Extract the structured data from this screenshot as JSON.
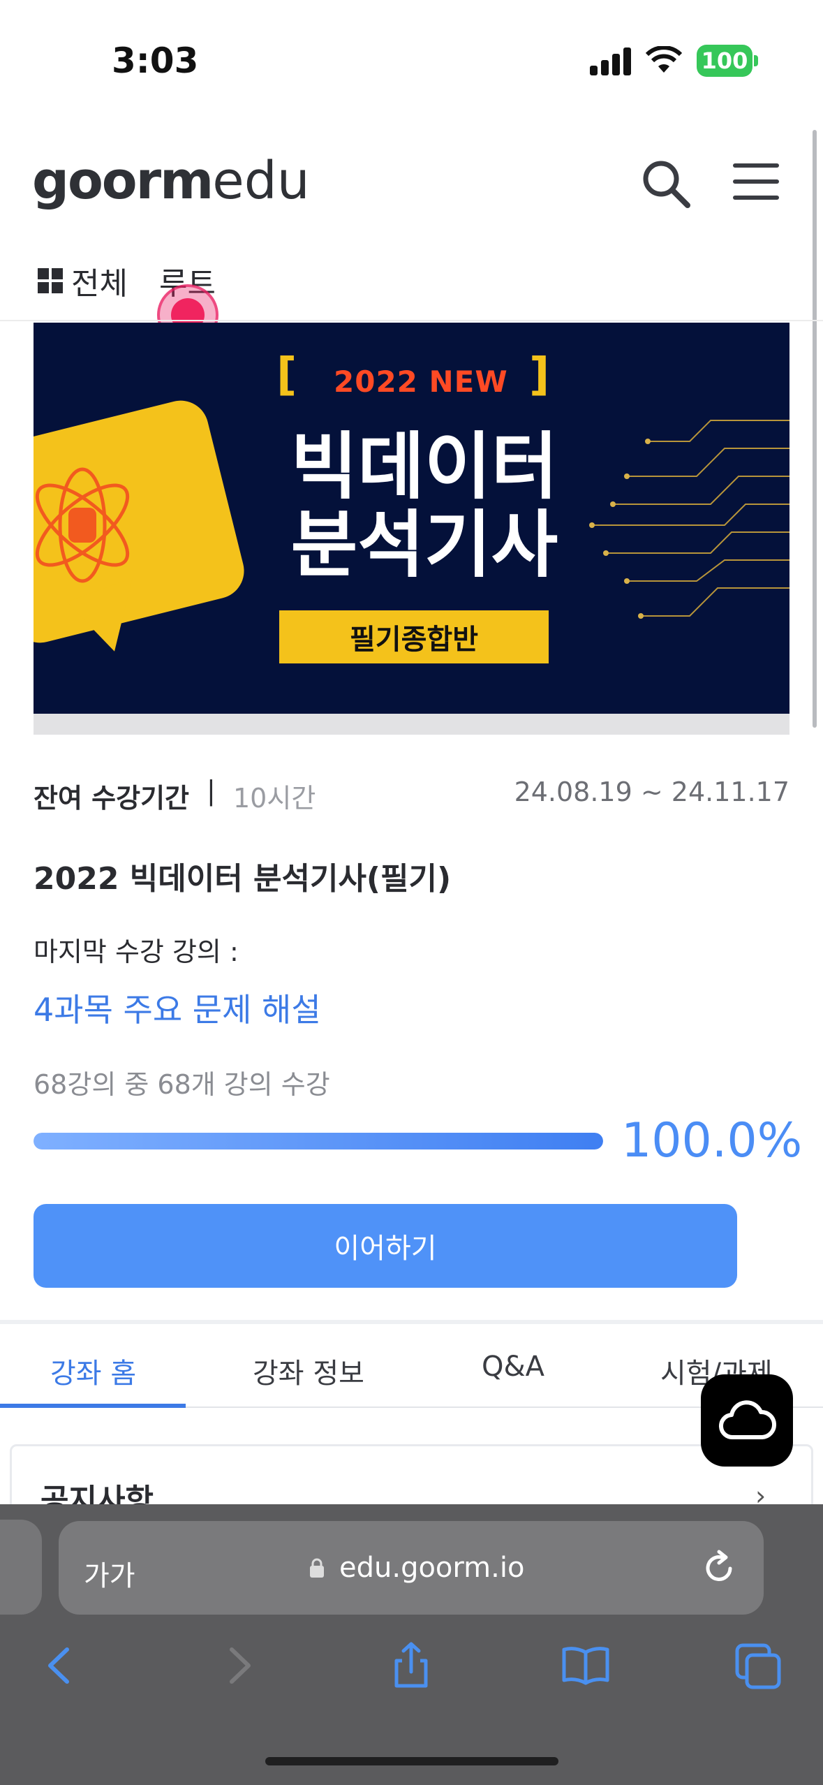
{
  "status": {
    "time": "3:03",
    "battery": "100"
  },
  "header": {
    "logo_goorm": "goorm",
    "logo_edu": "edu"
  },
  "categories": {
    "all": "전체",
    "root": "루트"
  },
  "banner": {
    "tag": "2022 NEW",
    "title_line1": "빅데이터",
    "title_line2": "분석기사",
    "subtitle": "필기종합반"
  },
  "course": {
    "period_label": "잔여 수강기간",
    "period_value": "10시간",
    "dates": "24.08.19 ~ 24.11.17",
    "title": "2022 빅데이터 분석기사(필기)",
    "last_label": "마지막 수강 강의 :",
    "last_lecture": "4과목 주요 문제 해설",
    "count": "68강의 중 68개 강의 수강",
    "progress": 1.0,
    "progress_text": "100.0%",
    "continue_label": "이어하기"
  },
  "tabs": [
    "강좌 홈",
    "강좌 정보",
    "Q&A",
    "시험/과제"
  ],
  "notice": {
    "title": "공지사항",
    "chevron": "›"
  },
  "browser": {
    "aa": "가가",
    "url": "edu.goorm.io"
  },
  "colors": {
    "accent": "#3c7ae6",
    "button": "#4f92f8",
    "banner_bg": "#04113a",
    "banner_yellow": "#f4c21b"
  }
}
